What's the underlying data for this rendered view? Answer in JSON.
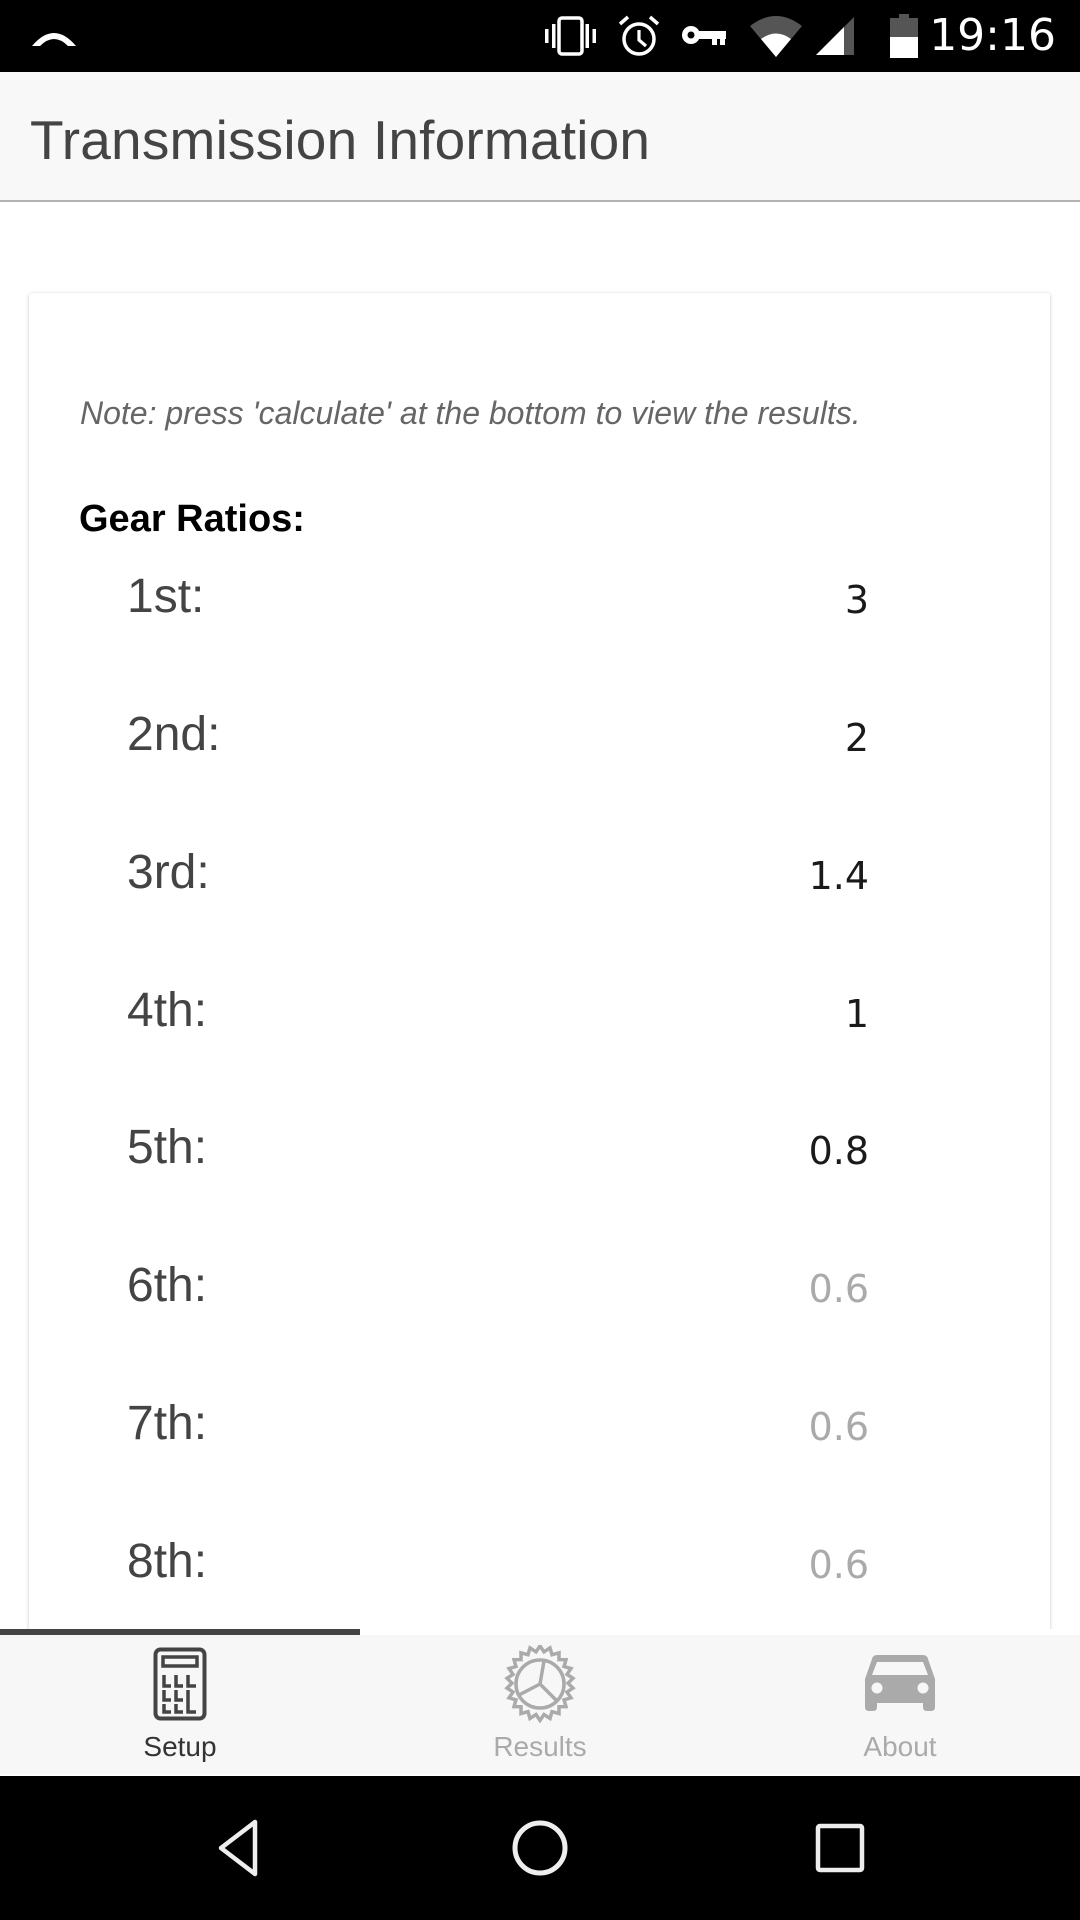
{
  "status_bar": {
    "time": "19:16",
    "icons": [
      "notification-arc-icon",
      "vibrate-icon",
      "alarm-icon",
      "vpn-key-icon",
      "wifi-icon",
      "cell-signal-icon",
      "battery-icon"
    ]
  },
  "header": {
    "title": "Transmission Information"
  },
  "card": {
    "note": "Note: press 'calculate' at the bottom to view the results.",
    "section_title": "Gear Ratios:",
    "gears": [
      {
        "label": "1st:",
        "value": "3",
        "placeholder": ""
      },
      {
        "label": "2nd:",
        "value": "2",
        "placeholder": ""
      },
      {
        "label": "3rd:",
        "value": "1.4",
        "placeholder": ""
      },
      {
        "label": "4th:",
        "value": "1",
        "placeholder": ""
      },
      {
        "label": "5th:",
        "value": "0.8",
        "placeholder": ""
      },
      {
        "label": "6th:",
        "value": "",
        "placeholder": "0.6"
      },
      {
        "label": "7th:",
        "value": "",
        "placeholder": "0.6"
      },
      {
        "label": "8th:",
        "value": "",
        "placeholder": "0.6"
      }
    ]
  },
  "tabs": [
    {
      "label": "Setup",
      "icon": "calculator-icon",
      "active": true
    },
    {
      "label": "Results",
      "icon": "gear-icon",
      "active": false
    },
    {
      "label": "About",
      "icon": "car-icon",
      "active": false
    }
  ],
  "colors": {
    "active_tab": "#333333",
    "inactive_tab": "#aaaaaa",
    "tab_indicator": "#444444",
    "header_bg": "#f8f8f8",
    "placeholder": "#aaaaaa"
  },
  "nav_bar": {
    "buttons": [
      "back-icon",
      "home-icon",
      "recents-icon"
    ]
  }
}
